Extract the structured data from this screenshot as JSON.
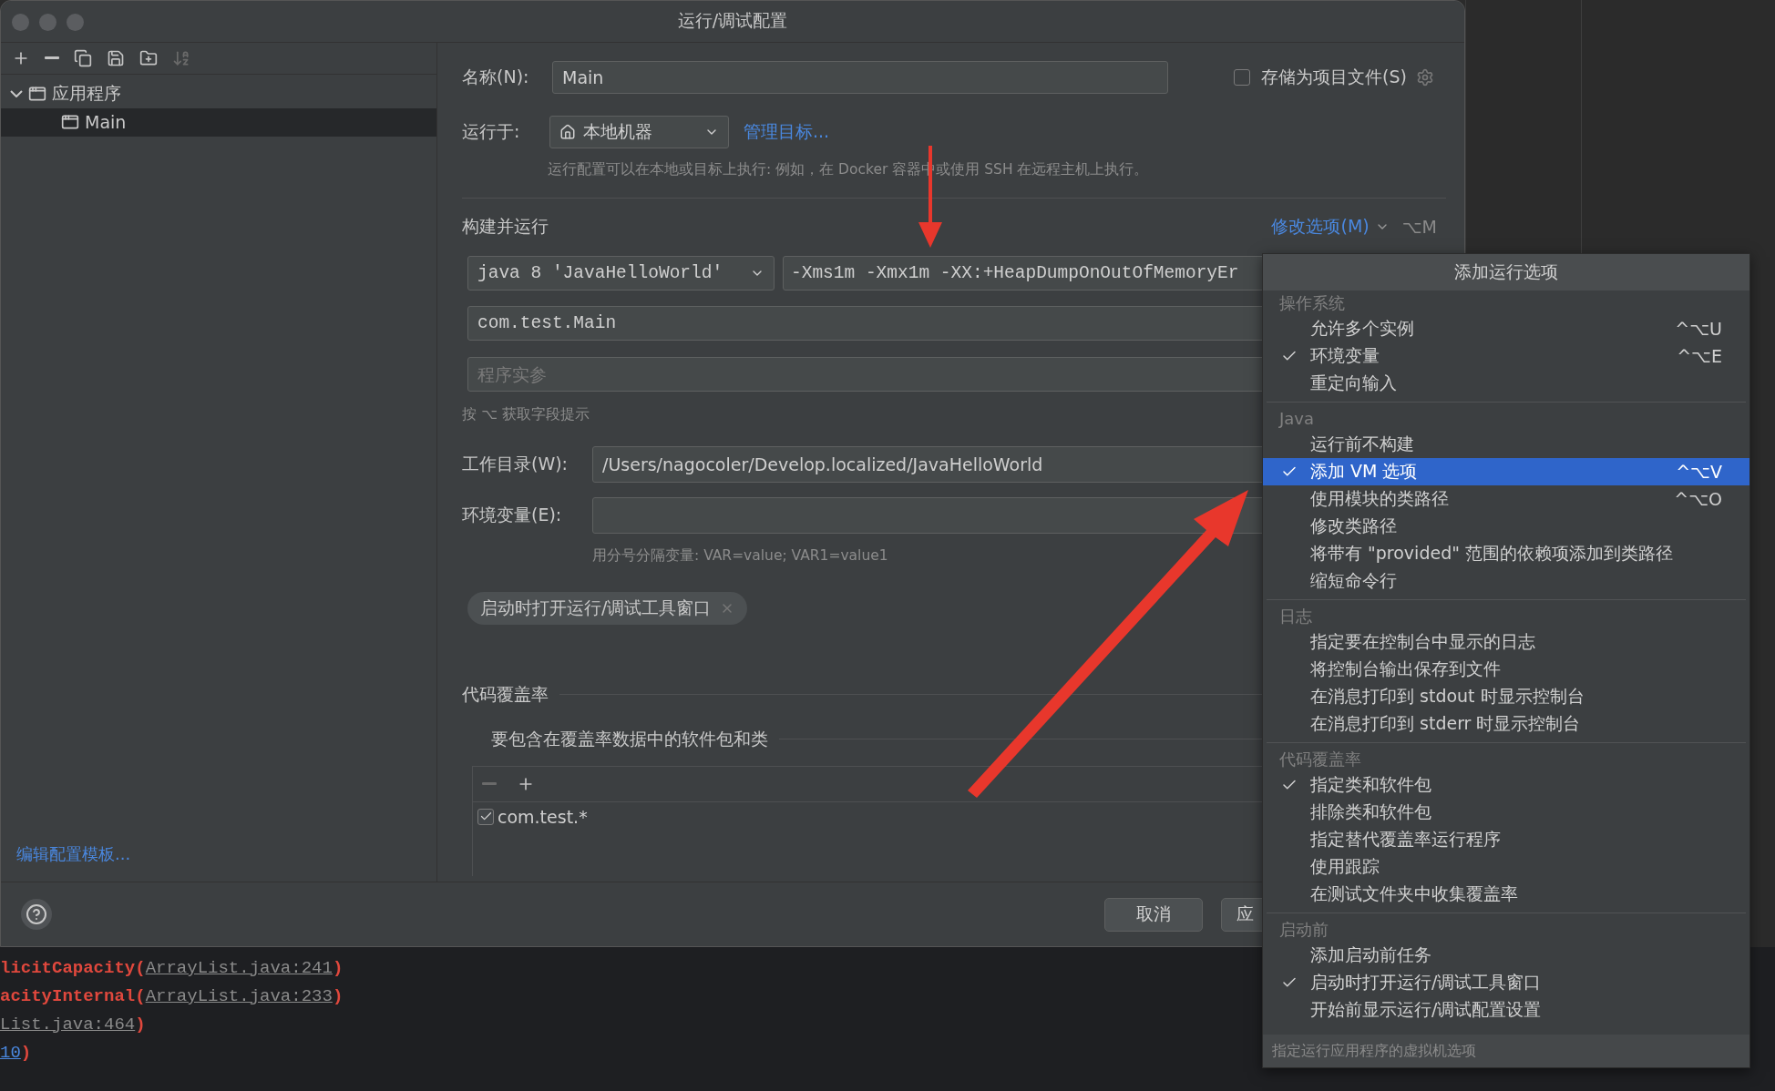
{
  "window": {
    "title": "运行/调试配置"
  },
  "sidebar": {
    "toolbar": [
      {
        "kind": "add",
        "disabled": false
      },
      {
        "kind": "remove",
        "disabled": false
      },
      {
        "kind": "copy",
        "disabled": false
      },
      {
        "kind": "save",
        "disabled": false
      },
      {
        "kind": "folder",
        "disabled": false
      },
      {
        "kind": "sort",
        "disabled": true
      }
    ],
    "tree": [
      {
        "label": "应用程序",
        "expanded": true,
        "selected": false,
        "children": [
          {
            "label": "Main",
            "selected": true
          }
        ]
      }
    ],
    "template_link": "编辑配置模板..."
  },
  "form": {
    "name_label": "名称(N):",
    "name_value": "Main",
    "store_label": "存储为项目文件(S)",
    "store_checked": false,
    "run_on_label": "运行于:",
    "run_on_value": "本地机器",
    "manage_link": "管理目标...",
    "run_on_hint": "运行配置可以在本地或目标上执行: 例如，在 Docker 容器中或使用 SSH 在远程主机上执行。",
    "build_section": "构建并运行",
    "modify_link": "修改选项(M)",
    "modify_shortcut": "⌥M",
    "jre_value": "java 8 'JavaHelloWorld'",
    "vm_options": "-Xms1m -Xmx1m -XX:+HeapDumpOnOutOfMemoryEr",
    "main_class": "com.test.Main",
    "args_placeholder": "程序实参",
    "field_hint": "按 ⌥ 获取字段提示",
    "workdir_label": "工作目录(W):",
    "workdir_value": "/Users/nagocoler/Develop.localized/JavaHelloWorld",
    "env_label": "环境变量(E):",
    "env_hint": "用分号分隔变量: VAR=value; VAR1=value1",
    "chips": [
      "启动时打开运行/调试工具窗口"
    ],
    "coverage_section": "代码覆盖率",
    "coverage_sub": "要包含在覆盖率数据中的软件包和类",
    "coverage_rows": [
      {
        "label": "com.test.*",
        "checked": true
      }
    ]
  },
  "buttons": [
    {
      "label": "取消",
      "kind": "cancel"
    },
    {
      "label": "应",
      "kind": "apply"
    }
  ],
  "menu": {
    "title": "添加运行选项",
    "sections": [
      {
        "title": "操作系统",
        "items": [
          {
            "label": "允许多个实例",
            "checked": false,
            "selected": false,
            "shortcut": "^⌥U"
          },
          {
            "label": "环境变量",
            "checked": true,
            "selected": false,
            "shortcut": "^⌥E"
          },
          {
            "label": "重定向输入",
            "checked": false,
            "selected": false
          }
        ]
      },
      {
        "title": "Java",
        "items": [
          {
            "label": "运行前不构建",
            "checked": false,
            "selected": false
          },
          {
            "label": "添加 VM 选项",
            "checked": true,
            "selected": true,
            "shortcut": "^⌥V"
          },
          {
            "label": "使用模块的类路径",
            "checked": false,
            "selected": false,
            "shortcut": "^⌥O"
          },
          {
            "label": "修改类路径",
            "checked": false,
            "selected": false
          },
          {
            "label": "将带有 \"provided\" 范围的依赖项添加到类路径",
            "checked": false,
            "selected": false
          },
          {
            "label": "缩短命令行",
            "checked": false,
            "selected": false
          }
        ]
      },
      {
        "title": "日志",
        "items": [
          {
            "label": "指定要在控制台中显示的日志",
            "checked": false,
            "selected": false
          },
          {
            "label": "将控制台输出保存到文件",
            "checked": false,
            "selected": false
          },
          {
            "label": "在消息打印到 stdout 时显示控制台",
            "checked": false,
            "selected": false
          },
          {
            "label": "在消息打印到 stderr 时显示控制台",
            "checked": false,
            "selected": false
          }
        ]
      },
      {
        "title": "代码覆盖率",
        "items": [
          {
            "label": "指定类和软件包",
            "checked": true,
            "selected": false
          },
          {
            "label": "排除类和软件包",
            "checked": false,
            "selected": false
          },
          {
            "label": "指定替代覆盖率运行程序",
            "checked": false,
            "selected": false
          },
          {
            "label": "使用跟踪",
            "checked": false,
            "selected": false
          },
          {
            "label": "在测试文件夹中收集覆盖率",
            "checked": false,
            "selected": false
          }
        ]
      },
      {
        "title": "启动前",
        "items": [
          {
            "label": "添加启动前任务",
            "checked": false,
            "selected": false
          },
          {
            "label": "启动时打开运行/调试工具窗口",
            "checked": true,
            "selected": false
          },
          {
            "label": "开始前显示运行/调试配置设置",
            "checked": false,
            "selected": false
          }
        ]
      }
    ],
    "footer": "指定运行应用程序的虚拟机选项"
  },
  "console": [
    [
      {
        "kind": "code",
        "text": "licitCapacity("
      },
      {
        "kind": "link",
        "text": "ArrayList.java:241"
      },
      {
        "kind": "code",
        "text": ")"
      }
    ],
    [
      {
        "kind": "code",
        "text": "acityInternal("
      },
      {
        "kind": "link",
        "text": "ArrayList.java:233"
      },
      {
        "kind": "code",
        "text": ")"
      }
    ],
    [
      {
        "kind": "link",
        "text": "List.java:464"
      },
      {
        "kind": "code",
        "text": ")"
      }
    ],
    [
      {
        "kind": "ref",
        "text": "10"
      },
      {
        "kind": "code",
        "text": ")"
      }
    ]
  ]
}
